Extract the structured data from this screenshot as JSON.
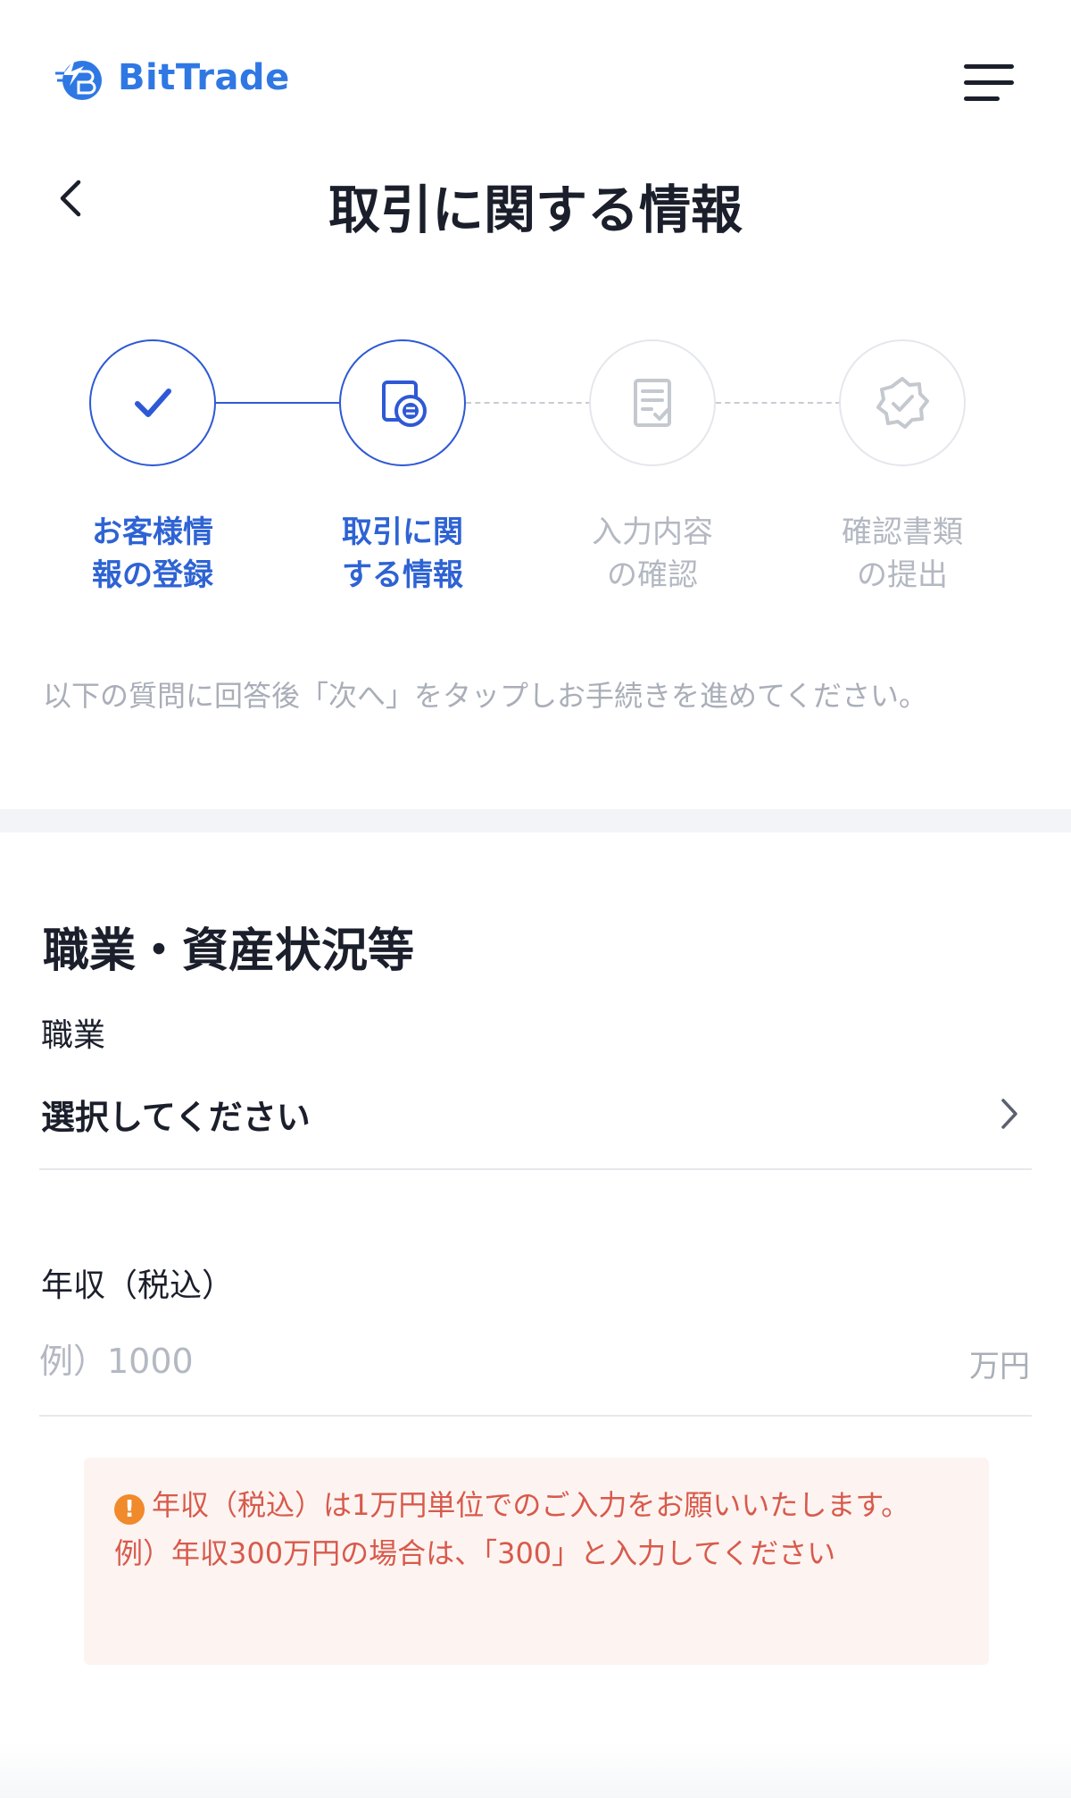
{
  "header": {
    "logo_text": "BitTrade",
    "menu_icon": "hamburger-icon",
    "back_icon": "chevron-left-icon",
    "page_title": "取引に関する情報"
  },
  "stepper": {
    "steps": [
      {
        "label_line1": "お客様情",
        "label_line2": "報の登録",
        "status": "done",
        "icon": "check-icon"
      },
      {
        "label_line1": "取引に関",
        "label_line2": "する情報",
        "status": "current",
        "icon": "trade-info-icon"
      },
      {
        "label_line1": "入力内容",
        "label_line2": "の確認",
        "status": "pending",
        "icon": "document-check-icon"
      },
      {
        "label_line1": "確認書類",
        "label_line2": "の提出",
        "status": "pending",
        "icon": "badge-check-icon"
      }
    ]
  },
  "instructions": "以下の質問に回答後「次へ」をタップしお手続きを進めてください。",
  "section": {
    "title": "職業・資産状況等",
    "occupation_label": "職業",
    "occupation_value": "選択してください",
    "income_label": "年収（税込）",
    "income_placeholder": "例）1000",
    "income_unit": "万円"
  },
  "notice": {
    "line1": "年収（税込）は1万円単位でのご入力をお願いいたします。",
    "line2": "例）年収300万円の場合は、「300」と入力してください"
  },
  "colors": {
    "accent": "#2e59d6",
    "brand": "#2f78e4",
    "notice_text": "#d85a4c",
    "notice_bg": "#fdf4f1",
    "warning_icon": "#f08a2a"
  }
}
